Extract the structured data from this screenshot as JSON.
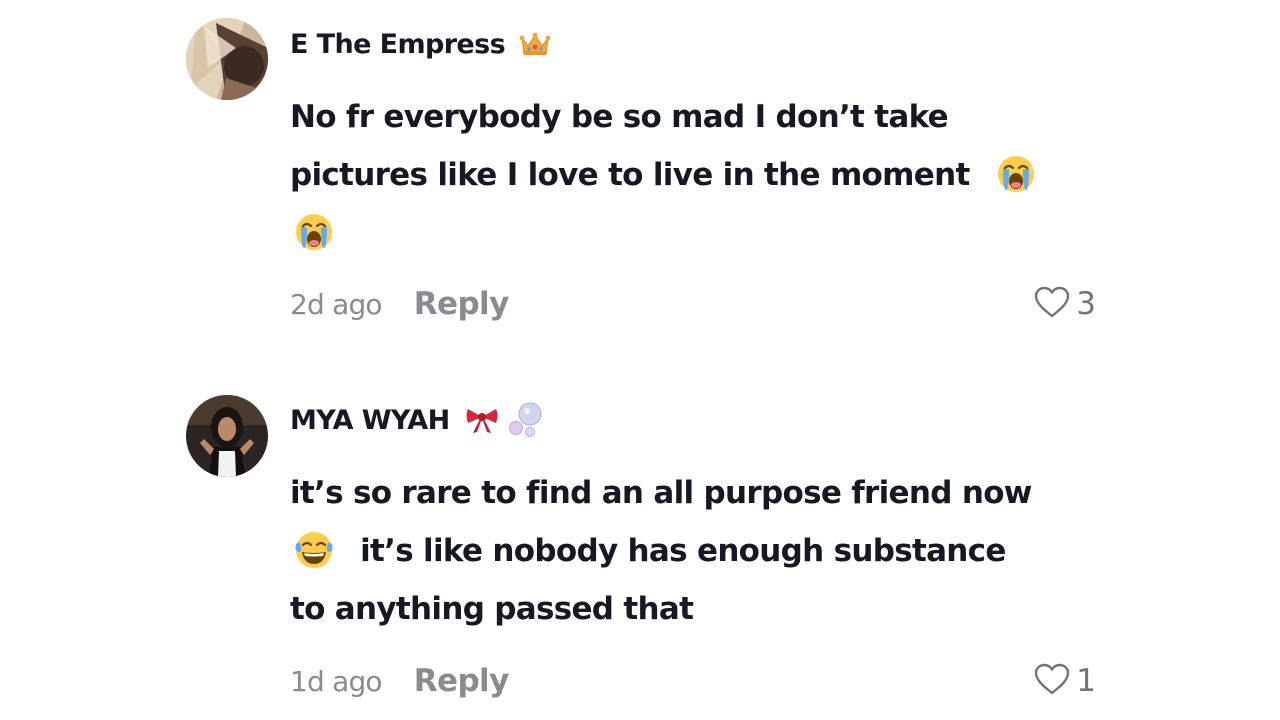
{
  "comments": [
    {
      "username": "E The Empress",
      "badges": [
        "crown-emoji"
      ],
      "lines": [
        "No fr everybody be so mad I don’t take",
        "pictures like I love to live in the moment"
      ],
      "line2_emoji": "loudly-crying-face-emoji",
      "line3_emoji": "loudly-crying-face-emoji",
      "timestamp": "2d ago",
      "reply_label": "Reply",
      "like_icon": "heart-outline-icon",
      "like_count": "3"
    },
    {
      "username": "MYA WYAH",
      "badges": [
        "ribbon-emoji",
        "bubbles-emoji"
      ],
      "lines": [
        "it’s so rare to find an all purpose friend now",
        "it’s like nobody has enough substance",
        "to anything passed that"
      ],
      "line2_emoji": "face-with-tears-of-joy-emoji",
      "timestamp": "1d ago",
      "reply_label": "Reply",
      "like_icon": "heart-outline-icon",
      "like_count": "1"
    }
  ],
  "colors": {
    "text_primary": "#161823",
    "text_secondary": "#8a8b91",
    "like_icon": "#73747b"
  }
}
